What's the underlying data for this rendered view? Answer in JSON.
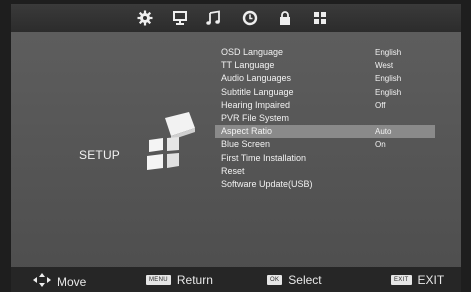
{
  "tabs": [
    {
      "name": "gear-icon"
    },
    {
      "name": "monitor-icon"
    },
    {
      "name": "music-note-icon"
    },
    {
      "name": "clock-icon"
    },
    {
      "name": "lock-icon"
    },
    {
      "name": "grid-icon"
    }
  ],
  "section": {
    "title": "SETUP"
  },
  "menu": [
    {
      "label": "OSD Language",
      "value": "English"
    },
    {
      "label": "TT Language",
      "value": "West"
    },
    {
      "label": "Audio Languages",
      "value": "English"
    },
    {
      "label": "Subtitle Language",
      "value": "English"
    },
    {
      "label": "Hearing Impaired",
      "value": "Off"
    },
    {
      "label": "PVR File System",
      "value": ""
    },
    {
      "label": "Aspect Ratio",
      "value": "Auto",
      "selected": true
    },
    {
      "label": "Blue Screen",
      "value": "On"
    },
    {
      "label": "First Time Installation",
      "value": ""
    },
    {
      "label": "Reset",
      "value": ""
    },
    {
      "label": "Software Update(USB)",
      "value": ""
    }
  ],
  "footer": {
    "move": {
      "label": "Move"
    },
    "menu": {
      "key": "MENU",
      "label": "Return"
    },
    "ok": {
      "key": "OK",
      "label": "Select"
    },
    "exit": {
      "key": "EXIT",
      "label": "EXIT"
    }
  },
  "colors": {
    "selected_row": "#8a8a8a",
    "text": "#f2f2f2",
    "background": "#555555"
  }
}
